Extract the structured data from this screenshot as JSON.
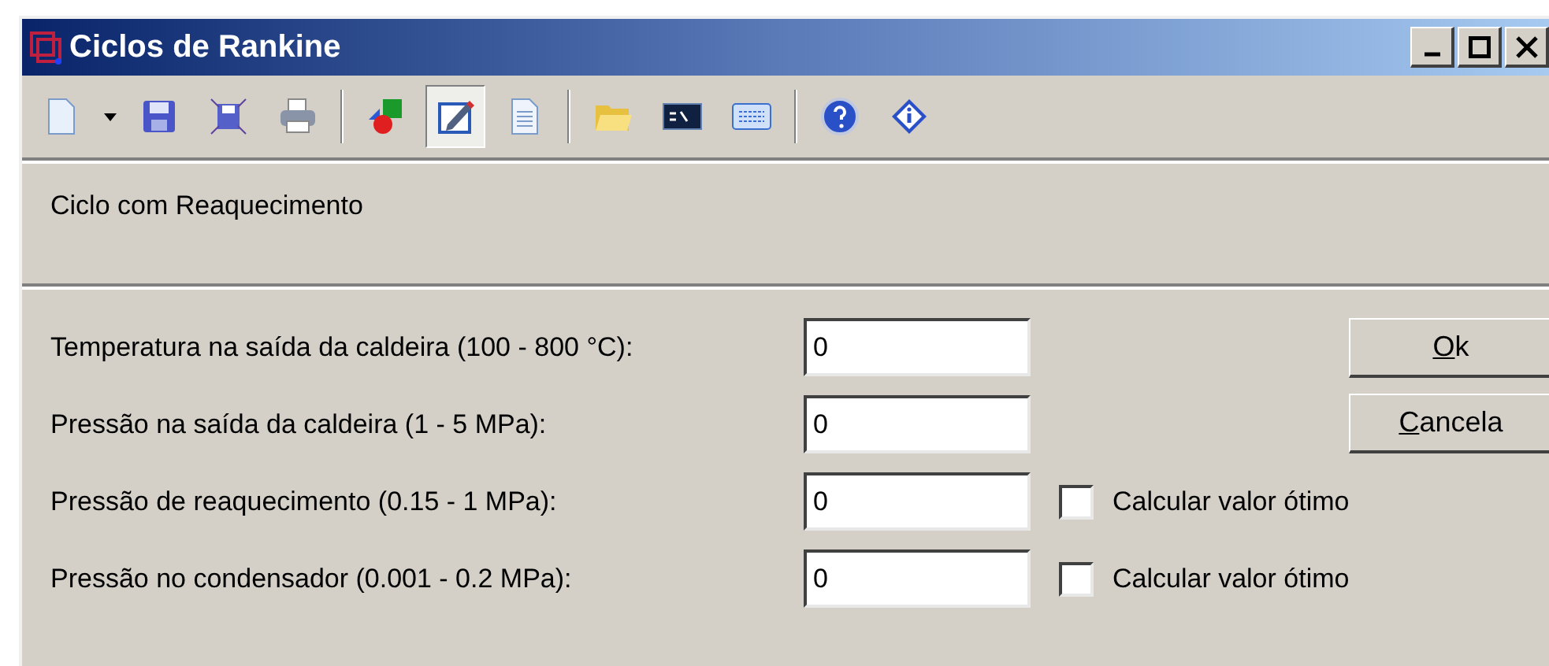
{
  "window": {
    "title": "Ciclos de Rankine"
  },
  "toolbar": [
    {
      "items": [
        {
          "kind": "new",
          "selected": false
        },
        {
          "kind": "caret",
          "selected": false
        },
        {
          "kind": "save",
          "selected": false
        },
        {
          "kind": "fit",
          "selected": false
        },
        {
          "kind": "print",
          "selected": false
        }
      ]
    },
    {
      "items": [
        {
          "kind": "shapes",
          "selected": false
        },
        {
          "kind": "edit",
          "selected": true
        },
        {
          "kind": "doc",
          "selected": false
        }
      ]
    },
    {
      "items": [
        {
          "kind": "folder",
          "selected": false
        },
        {
          "kind": "console",
          "selected": false
        },
        {
          "kind": "calc",
          "selected": false
        }
      ]
    },
    {
      "items": [
        {
          "kind": "help",
          "selected": false
        },
        {
          "kind": "info",
          "selected": false
        }
      ]
    }
  ],
  "header": "Ciclo com Reaquecimento",
  "fields": [
    {
      "label": "Temperatura na saída da caldeira (100 - 800 °C):",
      "value": "0"
    },
    {
      "label": "Pressão na saída da caldeira (1 - 5 MPa):",
      "value": "0"
    },
    {
      "label": "Pressão de reaquecimento (0.15 - 1 MPa):",
      "value": "0",
      "option": {
        "label": "Calcular valor ótimo",
        "checked": false
      }
    },
    {
      "label": "Pressão no condensador (0.001 - 0.2 MPa):",
      "value": "0",
      "option": {
        "label": "Calcular valor ótimo",
        "checked": false
      }
    }
  ],
  "buttons": [
    {
      "label": "Ok",
      "underline_first": true
    },
    {
      "label": "Cancela",
      "underline_first": true
    }
  ]
}
